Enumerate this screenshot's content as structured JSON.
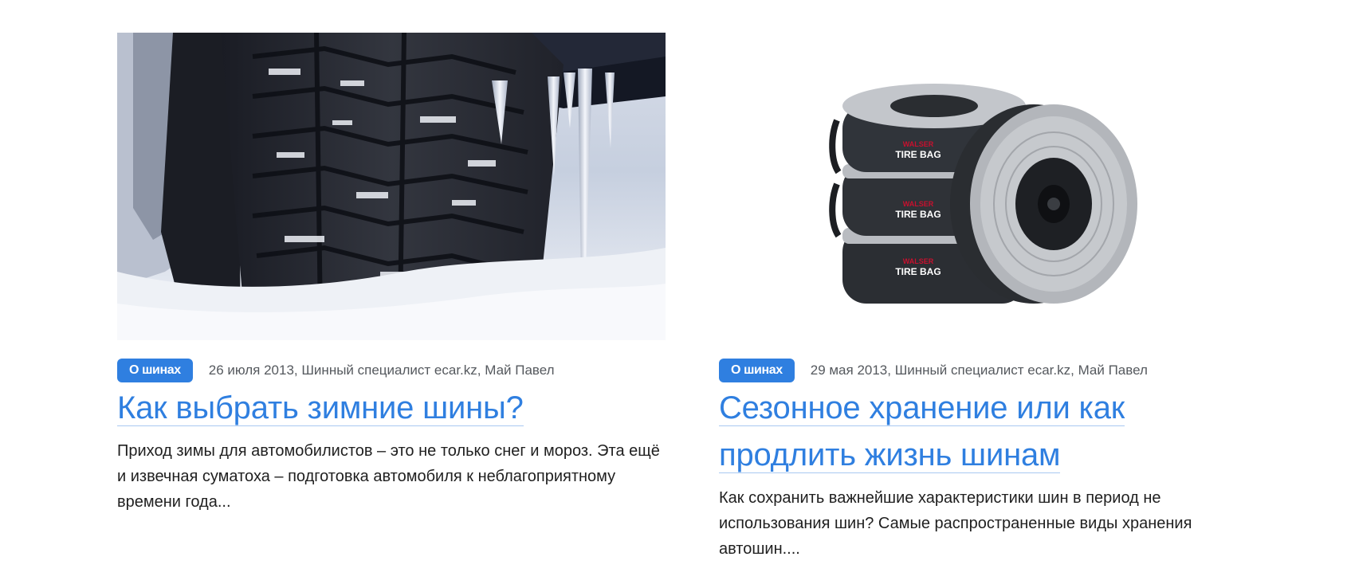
{
  "articles": [
    {
      "image": {
        "name": "winter-tire-in-snow-photo",
        "alt": ""
      },
      "tag": "О шинах",
      "meta": "26 июля 2013, Шинный специалист ecar.kz, Май Павел",
      "title": "Как выбрать зимние шины?",
      "excerpt": "Приход зимы для автомобилистов – это не только снег и мороз. Эта ещё и извечная суматоха – подготовка автомобиля к неблагоприятному времени года..."
    },
    {
      "image": {
        "name": "tire-bags-photo",
        "brand": "WALSER",
        "label": "TIRE BAG"
      },
      "tag": "О шинах",
      "meta": "29 мая 2013, Шинный специалист ecar.kz, Май Павел",
      "title": "Сезонное хранение или как продлить жизнь шинам",
      "excerpt": "Как сохранить важнейшие характеристики шин в период не использования шин? Самые распространенные виды хранения автошин...."
    }
  ],
  "colors": {
    "accent": "#2f7fe0",
    "meta_text": "#55595e",
    "body_text": "#1f1f1f",
    "brand_red": "#c8102e"
  }
}
